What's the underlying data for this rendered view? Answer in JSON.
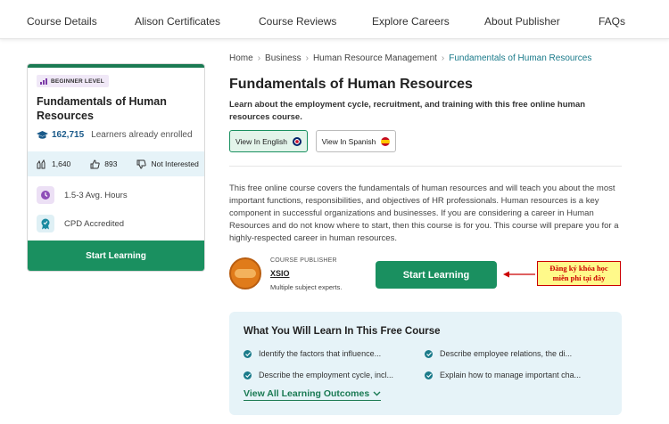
{
  "nav": {
    "items": [
      "Course Details",
      "Alison Certificates",
      "Course Reviews",
      "Explore Careers",
      "About Publisher",
      "FAQs"
    ]
  },
  "card": {
    "level": "BEGINNER LEVEL",
    "title": "Fundamentals of Human Resources",
    "enrolled_count": "162,715",
    "enrolled_label": "Learners already enrolled",
    "likes": "1,640",
    "thumbs": "893",
    "not_interested": "Not Interested",
    "hours": "1.5-3 Avg. Hours",
    "cpd": "CPD Accredited",
    "button": "Start Learning"
  },
  "breadcrumb": [
    "Home",
    "Business",
    "Human Resource Management",
    "Fundamentals of Human Resources"
  ],
  "course": {
    "title": "Fundamentals of Human Resources",
    "subtitle": "Learn about the employment cycle, recruitment, and training with this free online human resources course.",
    "view_english": "View In English",
    "view_spanish": "View In Spanish",
    "description": "This free online course covers the fundamentals of human resources and will teach you about the most important functions, responsibilities, and objectives of HR professionals. Human resources is a key component in successful organizations and businesses. If you are considering a career in Human Resources and do not know where to start, then this course is for you. This course will prepare you for a highly-respected career in human resources."
  },
  "publisher": {
    "label": "COURSE PUBLISHER",
    "name": "XSIO",
    "desc": "Multiple subject experts."
  },
  "cta": {
    "button": "Start Learning",
    "annotation_line1": "Đăng ký khóa học",
    "annotation_line2": "miễn phí tại đây"
  },
  "learn": {
    "title": "What You Will Learn In This Free Course",
    "items": [
      "Identify the factors that influence...",
      "Describe employee relations, the di...",
      "Describe the employment cycle, incl...",
      "Explain how to manage important cha..."
    ],
    "view_all": "View All Learning Outcomes"
  },
  "colors": {
    "primary_green": "#1a9060",
    "teal": "#1a7a8a",
    "light_blue": "#e6f3f8",
    "annotation_bg": "#fff98a",
    "annotation_red": "#cc0000"
  }
}
